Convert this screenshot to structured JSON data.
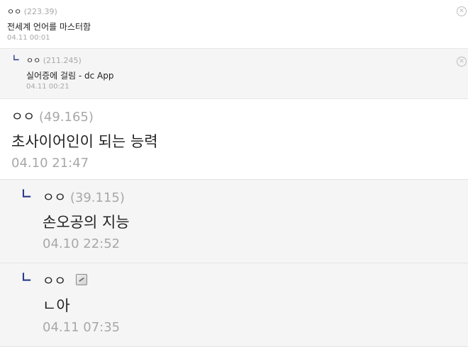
{
  "comments": [
    {
      "name": "ㅇㅇ",
      "ip": "(223.39)",
      "text": "전세계 언어를 마스터함",
      "date": "04.11 00:01",
      "reply": false
    },
    {
      "name": "ㅇㅇ",
      "ip": "(211.245)",
      "text": "실어증에 걸림 - dc App",
      "date": "04.11 00:21",
      "reply": true
    },
    {
      "name": "ㅇㅇ",
      "ip": "(49.165)",
      "text": "초사이어인이 되는 능력",
      "date": "04.10 21:47",
      "reply": false
    },
    {
      "name": "ㅇㅇ",
      "ip": "(39.115)",
      "text": "손오공의 지능",
      "date": "04.10 22:52",
      "reply": true
    },
    {
      "name": "ㅇㅇ",
      "ip": "",
      "text": "ㄴ아",
      "date": "04.11 07:35",
      "reply": true
    }
  ],
  "icons": {
    "reply_arrow": "reply-arrow-icon",
    "delete": "close-circle-icon",
    "memo": "fixed-nick-memo-icon"
  },
  "colors": {
    "reply_arrow": "#2b3c8c",
    "reply_background": "#f5f5f5",
    "muted_text": "#a8a8a8"
  }
}
